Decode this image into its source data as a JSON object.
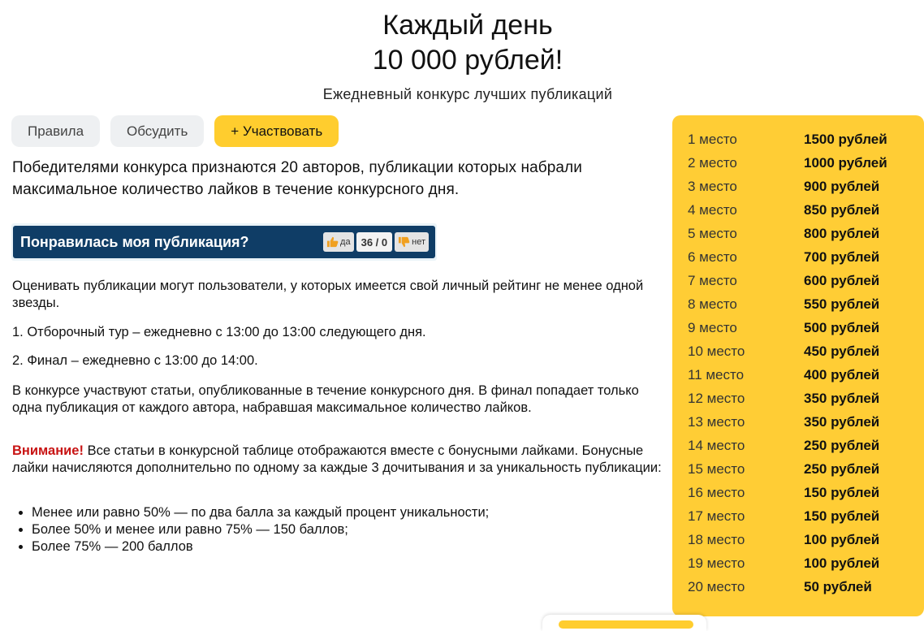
{
  "header": {
    "title_line1": "Каждый день",
    "title_line2": "10 000 рублей!",
    "subtitle": "Ежедневный конкурс лучших публикаций"
  },
  "tabs": {
    "rules": "Правила",
    "discuss": "Обсудить",
    "participate": "+ Участвовать"
  },
  "intro": "Победителями конкурса признаются 20 авторов, публикации которых набрали максимальное количество лайков в течение конкурсного дня.",
  "rating_widget": {
    "question": "Понравилась моя публикация?",
    "yes_label": "да",
    "count": "36 / 0",
    "no_label": "нет"
  },
  "paragraphs": {
    "voters": "Оценивать публикации могут пользователи, у которых имеется свой личный рейтинг не менее одной звезды.",
    "round1": "1. Отборочный тур – ежедневно с 13:00 до 13:00 следующего дня.",
    "round2": "2. Финал – ежедневно с 13:00 до 14:00.",
    "articles": "В конкурсе участвуют статьи, опубликованные в течение конкурсного дня. В финал попадает только одна публикация от каждого автора, набравшая максимальное количество лайков.",
    "warning_label": "Внимание!",
    "warning_text": " Все статьи в конкурсной таблице отображаются вместе с бонусными лайками. Бонусные лайки начисляются дополнительно по одному за каждые 3 дочитывания и за уникальность публикации:"
  },
  "bullets": [
    "Менее или равно 50% — по два балла за каждый процент уникальности;",
    "Более 50% и менее или равно 75% — 150 баллов;",
    "Более 75% — 200 баллов"
  ],
  "prizes": [
    {
      "place": "1 место",
      "amount": "1500 рублей"
    },
    {
      "place": "2 место",
      "amount": "1000 рублей"
    },
    {
      "place": "3 место",
      "amount": "900 рублей"
    },
    {
      "place": "4 место",
      "amount": "850 рублей"
    },
    {
      "place": "5 место",
      "amount": "800 рублей"
    },
    {
      "place": "6 место",
      "amount": "700 рублей"
    },
    {
      "place": "7 место",
      "amount": "600 рублей"
    },
    {
      "place": "8 место",
      "amount": "550 рублей"
    },
    {
      "place": "9 место",
      "amount": "500 рублей"
    },
    {
      "place": "10 место",
      "amount": "450 рублей"
    },
    {
      "place": "11 место",
      "amount": "400 рублей"
    },
    {
      "place": "12 место",
      "amount": "350 рублей"
    },
    {
      "place": "13 место",
      "amount": "350 рублей"
    },
    {
      "place": "14 место",
      "amount": "250 рублей"
    },
    {
      "place": "15 место",
      "amount": "250 рублей"
    },
    {
      "place": "16 место",
      "amount": "150 рублей"
    },
    {
      "place": "17 место",
      "amount": "150 рублей"
    },
    {
      "place": "18 место",
      "amount": "100 рублей"
    },
    {
      "place": "19 место",
      "amount": "100 рублей"
    },
    {
      "place": "20 место",
      "amount": "50 рублей"
    }
  ],
  "colors": {
    "accent_yellow": "#ffcd35",
    "banner_blue": "#0f3d66",
    "warning_red": "#c81414"
  }
}
